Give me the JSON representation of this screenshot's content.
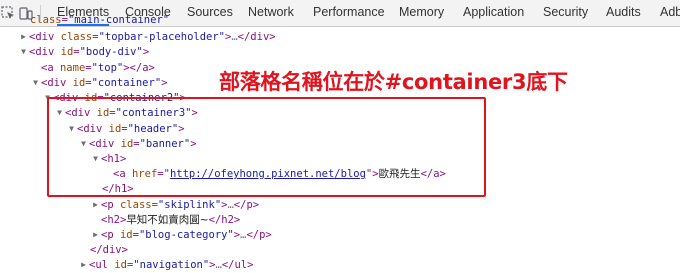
{
  "tabs": [
    "Elements",
    "Console",
    "Sources",
    "Network",
    "Performance",
    "Memory",
    "Application",
    "Security",
    "Audits",
    "Adb"
  ],
  "active_tab": "Elements",
  "accent_color": "#1a73e8",
  "annotation": "部落格名稱位在於#container3底下",
  "annotation_color": "#e0141e",
  "dom": {
    "r0": {
      "attr": "class",
      "val": "\"main-container\""
    },
    "r1": {
      "tag": "div",
      "attr": "class",
      "val": "\"topbar-placeholder\"",
      "ell": "…",
      "close": "</div>"
    },
    "r2": {
      "tag": "div",
      "attr": "id",
      "val": "\"body-div\""
    },
    "r3": {
      "tag": "a",
      "attr": "name",
      "val": "\"top\"",
      "close": "</a>"
    },
    "r4": {
      "tag": "div",
      "attr": "id",
      "val": "\"container\""
    },
    "r5": {
      "tag": "div",
      "attr": "id",
      "val": "\"container2\""
    },
    "r6": {
      "tag": "div",
      "attr": "id",
      "val": "\"container3\""
    },
    "r7": {
      "tag": "div",
      "attr": "id",
      "val": "\"header\""
    },
    "r8": {
      "tag": "div",
      "attr": "id",
      "val": "\"banner\""
    },
    "r9": {
      "tag": "h1"
    },
    "r10": {
      "tag": "a",
      "attr": "href",
      "val": "http://ofeyhong.pixnet.net/blog",
      "text": "歐飛先生",
      "close": "</a>"
    },
    "r11": {
      "close": "</h1>"
    },
    "r12": {
      "tag": "p",
      "attr": "class",
      "val": "\"skiplink\"",
      "ell": "…",
      "close": "</p>"
    },
    "r13": {
      "tag": "h2",
      "text": "早知不如賣肉圓~",
      "close": "</h2>"
    },
    "r14": {
      "tag": "p",
      "attr": "id",
      "val": "\"blog-category\"",
      "ell": "…",
      "close": "</p>"
    },
    "r15": {
      "close": "</div>"
    },
    "r16": {
      "tag": "ul",
      "attr": "id",
      "val": "\"navigation\"",
      "ell": "…",
      "close": "</ul>"
    }
  }
}
